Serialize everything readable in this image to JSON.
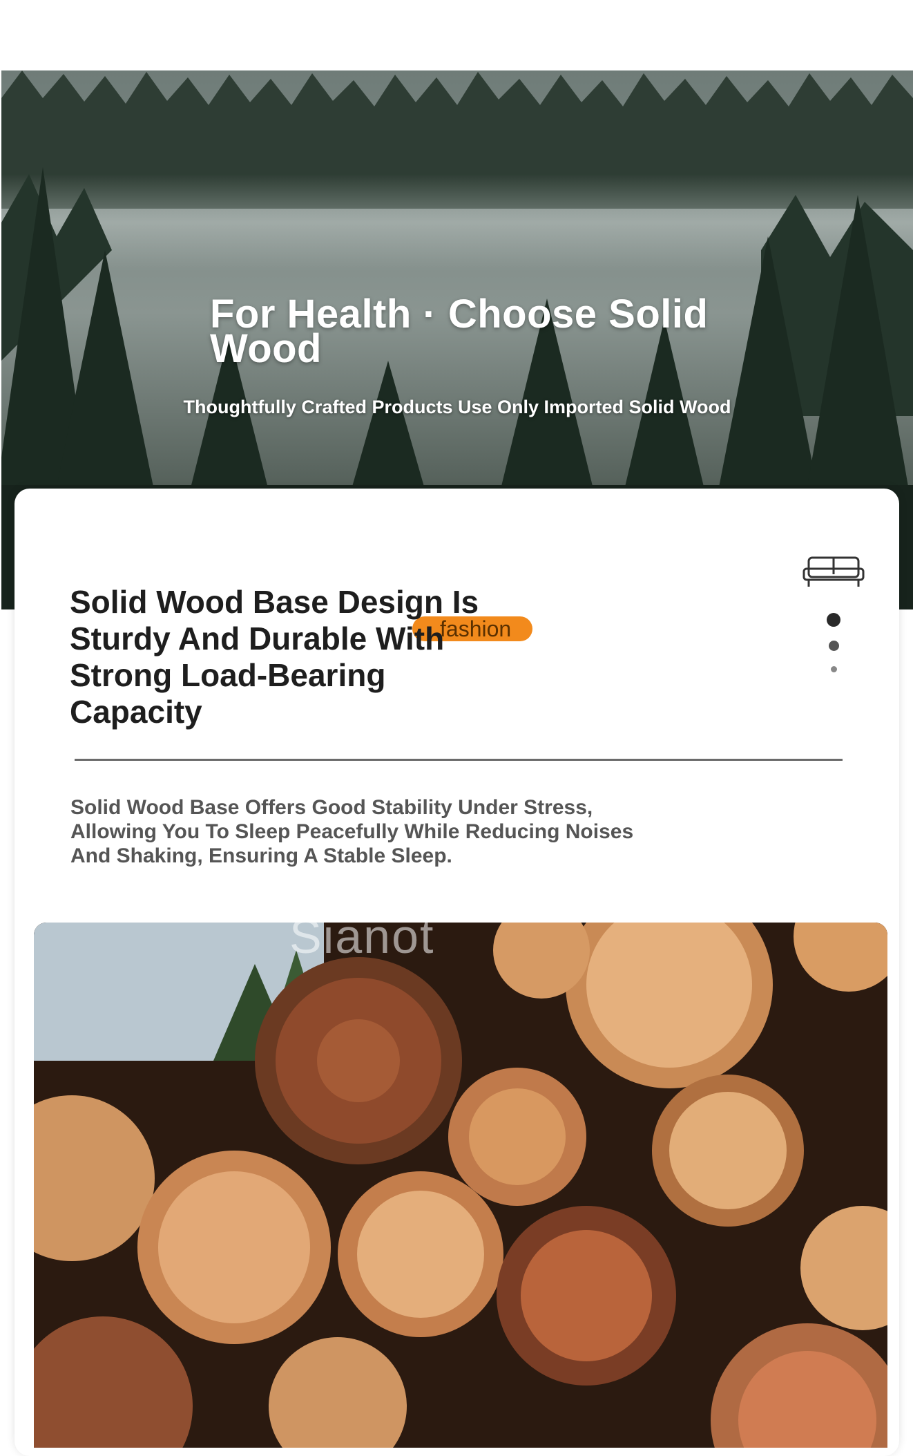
{
  "hero": {
    "title": "For Health · Choose Solid Wood",
    "subtitle": "Thoughtfully Crafted Products Use Only Imported Solid Wood"
  },
  "feature": {
    "title": "Solid Wood Base Design Is Sturdy And Durable With Strong Load-Bearing Capacity",
    "tag": "fashion",
    "description": "Solid Wood Base Offers Good Stability Under Stress, Allowing You To Sleep Peacefully While Reducing Noises And Shaking, Ensuring A Stable Sleep.",
    "icon": "sofa-icon",
    "pager": {
      "count": 3,
      "active": 1
    }
  },
  "photo": {
    "watermark": "Sianot"
  },
  "colors": {
    "tag": "#f28a1c",
    "title": "#1e1e1e",
    "description": "#555555"
  }
}
